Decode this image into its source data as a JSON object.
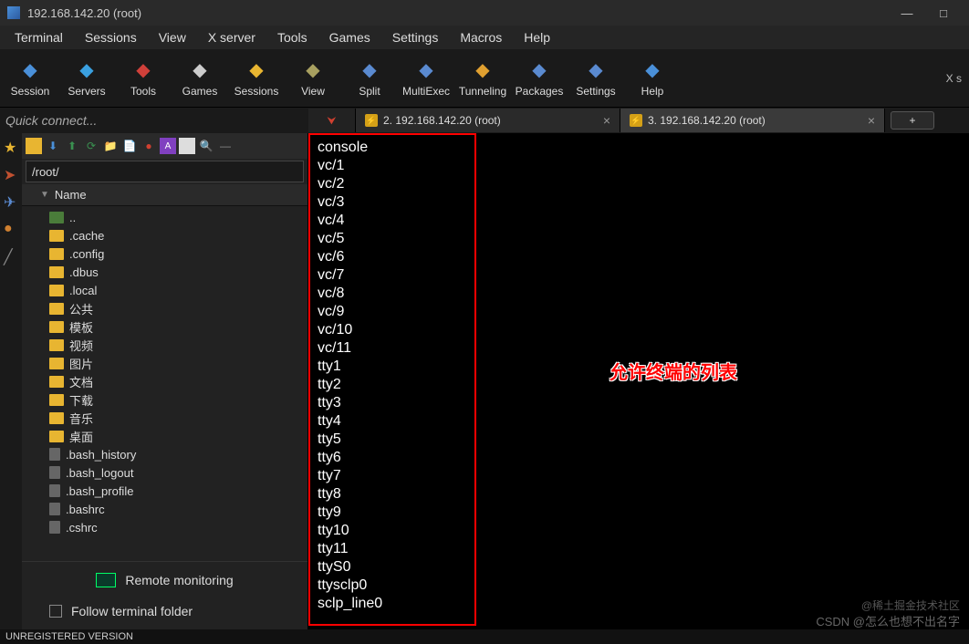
{
  "window": {
    "title": "192.168.142.20 (root)"
  },
  "menu": [
    "Terminal",
    "Sessions",
    "View",
    "X server",
    "Tools",
    "Games",
    "Settings",
    "Macros",
    "Help"
  ],
  "toolbar": [
    {
      "label": "Session",
      "color": "#4a90d9"
    },
    {
      "label": "Servers",
      "color": "#3aa0e0"
    },
    {
      "label": "Tools",
      "color": "#d0403a"
    },
    {
      "label": "Games",
      "color": "#ccc"
    },
    {
      "label": "Sessions",
      "color": "#e8b531"
    },
    {
      "label": "View",
      "color": "#a8a060"
    },
    {
      "label": "Split",
      "color": "#5a8ad0"
    },
    {
      "label": "MultiExec",
      "color": "#5a8ad0"
    },
    {
      "label": "Tunneling",
      "color": "#e0a030"
    },
    {
      "label": "Packages",
      "color": "#5a8ad0"
    },
    {
      "label": "Settings",
      "color": "#5a8ad0"
    },
    {
      "label": "Help",
      "color": "#4a90d9"
    }
  ],
  "toolbar_right": "X s",
  "quick_connect": "Quick connect...",
  "tabs": {
    "t1": "2. 192.168.142.20 (root)",
    "t2": "3. 192.168.142.20 (root)",
    "new": "+"
  },
  "sidebar": {
    "path": "/root/",
    "header": "Name",
    "items": [
      {
        "name": "..",
        "cls": "up"
      },
      {
        "name": ".cache",
        "cls": "folder-y"
      },
      {
        "name": ".config",
        "cls": "folder-y"
      },
      {
        "name": ".dbus",
        "cls": "folder-y"
      },
      {
        "name": ".local",
        "cls": "folder-y"
      },
      {
        "name": "公共",
        "cls": "folder-y"
      },
      {
        "name": "模板",
        "cls": "folder-y"
      },
      {
        "name": "视频",
        "cls": "folder-y"
      },
      {
        "name": "图片",
        "cls": "folder-y"
      },
      {
        "name": "文档",
        "cls": "folder-y"
      },
      {
        "name": "下载",
        "cls": "folder-y"
      },
      {
        "name": "音乐",
        "cls": "folder-y"
      },
      {
        "name": "桌面",
        "cls": "folder-y"
      },
      {
        "name": ".bash_history",
        "cls": "file-g"
      },
      {
        "name": ".bash_logout",
        "cls": "file-g"
      },
      {
        "name": ".bash_profile",
        "cls": "file-g"
      },
      {
        "name": ".bashrc",
        "cls": "file-g"
      },
      {
        "name": ".cshrc",
        "cls": "file-g"
      }
    ],
    "remote_monitoring": "Remote monitoring",
    "follow_terminal": "Follow terminal folder"
  },
  "terminal_lines": [
    "console",
    "vc/1",
    "vc/2",
    "vc/3",
    "vc/4",
    "vc/5",
    "vc/6",
    "vc/7",
    "vc/8",
    "vc/9",
    "vc/10",
    "vc/11",
    "tty1",
    "tty2",
    "tty3",
    "tty4",
    "tty5",
    "tty6",
    "tty7",
    "tty8",
    "tty9",
    "tty10",
    "tty11",
    "ttyS0",
    "ttysclp0",
    "sclp_line0"
  ],
  "annotation": "允许终端的列表",
  "watermark1": "@稀土掘金技术社区",
  "watermark2": "CSDN @怎么也想不出名字",
  "status": "UNREGISTERED VERSION"
}
